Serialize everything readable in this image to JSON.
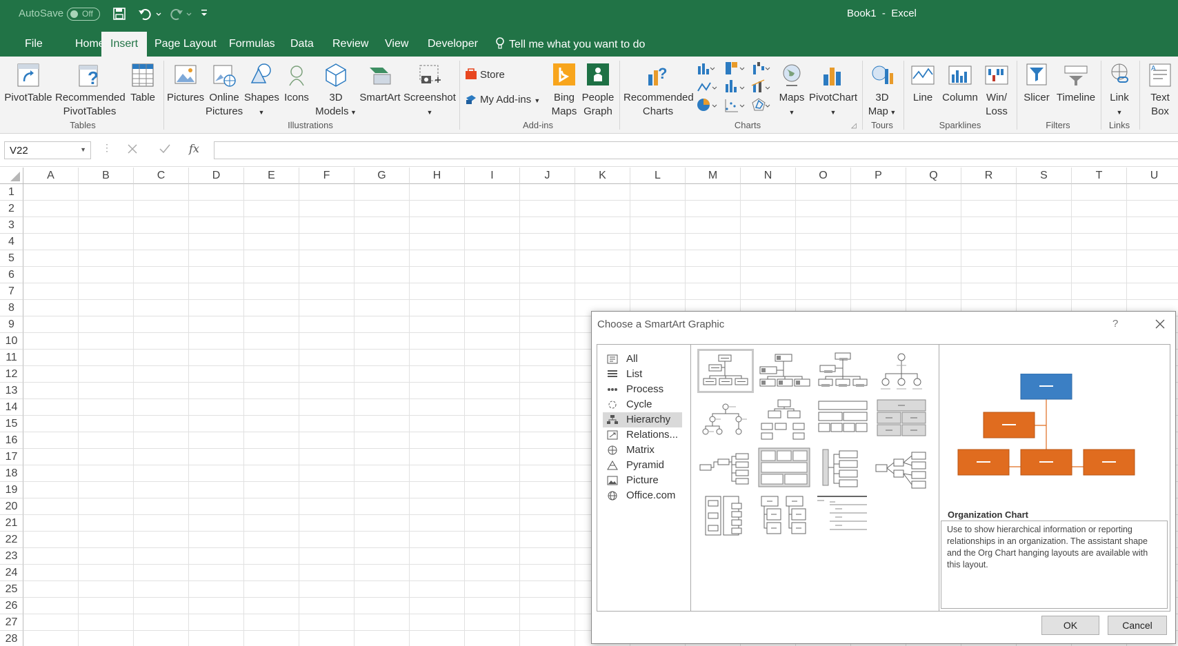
{
  "title_bar": {
    "autosave_label": "AutoSave",
    "autosave_state": "Off",
    "doc_title": "Book1  -  Excel"
  },
  "tabs": [
    "File",
    "Home",
    "Insert",
    "Page Layout",
    "Formulas",
    "Data",
    "Review",
    "View",
    "Developer"
  ],
  "tell_me": "Tell me what you want to do",
  "ribbon": {
    "pivottable": "PivotTable",
    "rec_pivot_1": "Recommended",
    "rec_pivot_2": "PivotTables",
    "table": "Table",
    "pictures": "Pictures",
    "online_1": "Online",
    "online_2": "Pictures",
    "shapes": "Shapes",
    "icons": "Icons",
    "models_1": "3D",
    "models_2": "Models",
    "smartart": "SmartArt",
    "screenshot": "Screenshot",
    "store": "Store",
    "my_addins": "My Add-ins",
    "bing_1": "Bing",
    "bing_2": "Maps",
    "people_1": "People",
    "people_2": "Graph",
    "rec_charts_1": "Recommended",
    "rec_charts_2": "Charts",
    "maps": "Maps",
    "pivotchart": "PivotChart",
    "map3d_1": "3D",
    "map3d_2": "Map",
    "line": "Line",
    "column": "Column",
    "winloss_1": "Win/",
    "winloss_2": "Loss",
    "slicer": "Slicer",
    "timeline": "Timeline",
    "link": "Link",
    "textbox_1": "Text",
    "textbox_2": "Box",
    "groups": {
      "tables": "Tables",
      "illustrations": "Illustrations",
      "addins": "Add-ins",
      "charts": "Charts",
      "tours": "Tours",
      "sparklines": "Sparklines",
      "filters": "Filters",
      "links": "Links"
    }
  },
  "formula_bar": {
    "name_box": "V22",
    "fx": "fx",
    "formula": ""
  },
  "columns": [
    "A",
    "B",
    "C",
    "D",
    "E",
    "F",
    "G",
    "H",
    "I",
    "J",
    "K",
    "L",
    "M",
    "N",
    "O",
    "P",
    "Q",
    "R",
    "S",
    "T",
    "U"
  ],
  "rows": [
    "1",
    "2",
    "3",
    "4",
    "5",
    "6",
    "7",
    "8",
    "9",
    "10",
    "11",
    "12",
    "13",
    "14",
    "15",
    "16",
    "17",
    "18",
    "19",
    "20",
    "21",
    "22",
    "23",
    "24",
    "25",
    "26",
    "27",
    "28"
  ],
  "dialog": {
    "title": "Choose a SmartArt Graphic",
    "help": "?",
    "categories": [
      "All",
      "List",
      "Process",
      "Cycle",
      "Hierarchy",
      "Relations...",
      "Matrix",
      "Pyramid",
      "Picture",
      "Office.com"
    ],
    "selected_category": "Hierarchy",
    "preview": {
      "name": "Organization Chart",
      "description": "Use to show hierarchical information or reporting relationships in an organization. The assistant shape and the Org Chart hanging layouts are available with this layout."
    },
    "ok": "OK",
    "cancel": "Cancel"
  },
  "colors": {
    "excel_green": "#217346",
    "preview_blue": "#3b7fc4",
    "preview_orange": "#e06c1f"
  }
}
